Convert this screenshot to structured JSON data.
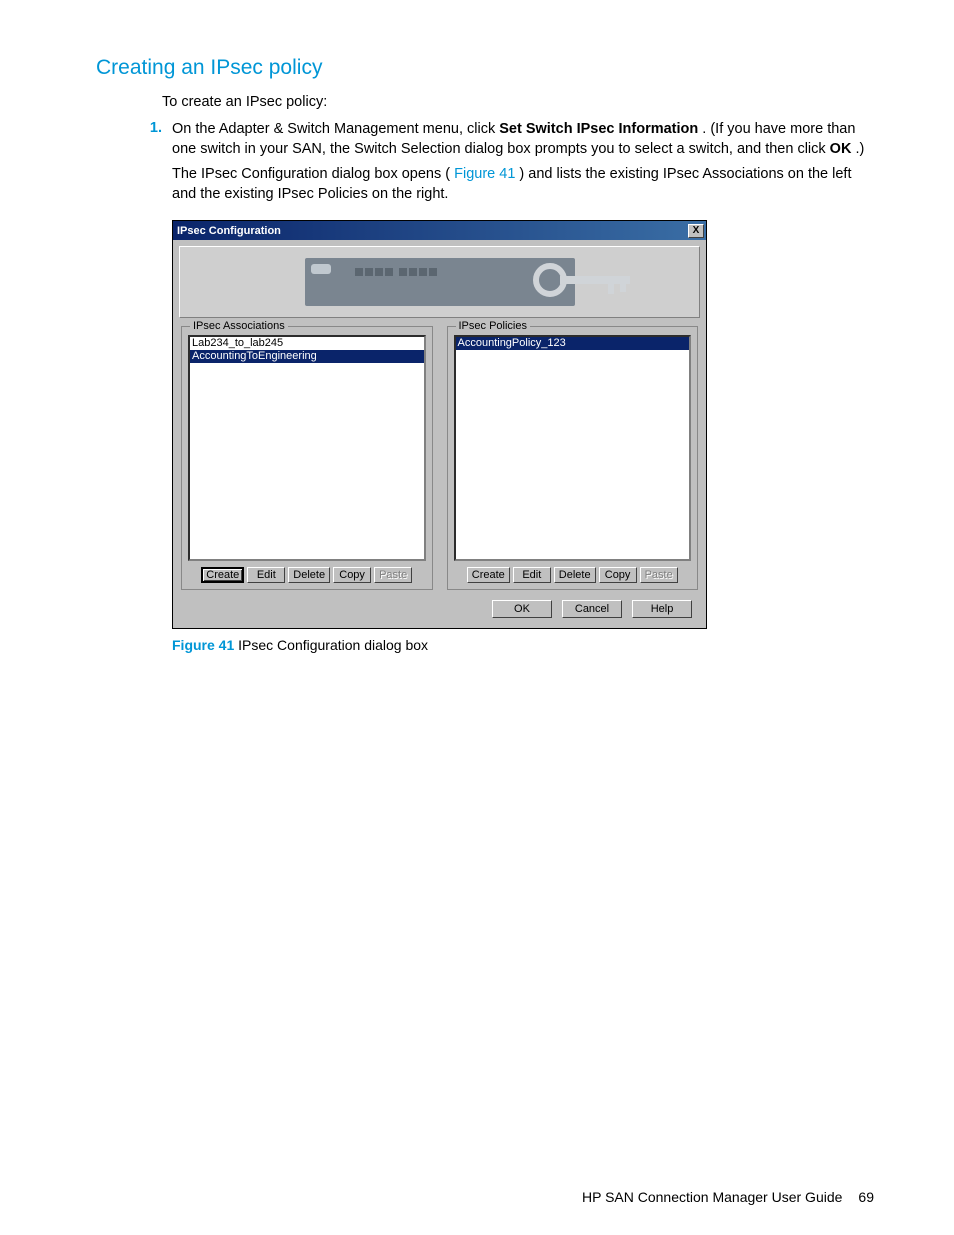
{
  "heading": "Creating an IPsec policy",
  "intro": "To create an IPsec policy:",
  "step_num": "1.",
  "step_a": "On the Adapter & Switch Management menu, click ",
  "step_bold1": "Set Switch IPsec Information",
  "step_b": ". (If you have more than one switch in your SAN, the Switch Selection dialog box prompts you to select a switch, and then click ",
  "step_bold2": "OK",
  "step_c": ".)",
  "step_d1": "The IPsec Configuration dialog box opens (",
  "step_figref": "Figure 41",
  "step_d2": ") and lists the existing IPsec Associations on the left and the existing IPsec Policies on the right.",
  "dialog": {
    "title": "IPsec Configuration",
    "close": "X",
    "associations_legend": "IPsec Associations",
    "policies_legend": "IPsec Policies",
    "assoc_items": [
      "Lab234_to_lab245",
      "AccountingToEngineering"
    ],
    "policy_items": [
      "AccountingPolicy_123"
    ],
    "buttons": {
      "create": "Create",
      "edit": "Edit",
      "delete": "Delete",
      "copy": "Copy",
      "paste": "Paste"
    },
    "bottom": {
      "ok": "OK",
      "cancel": "Cancel",
      "help": "Help"
    }
  },
  "caption_label": "Figure 41",
  "caption_text": " IPsec Configuration dialog box",
  "footer_title": "HP SAN Connection Manager User Guide",
  "footer_page": "69"
}
